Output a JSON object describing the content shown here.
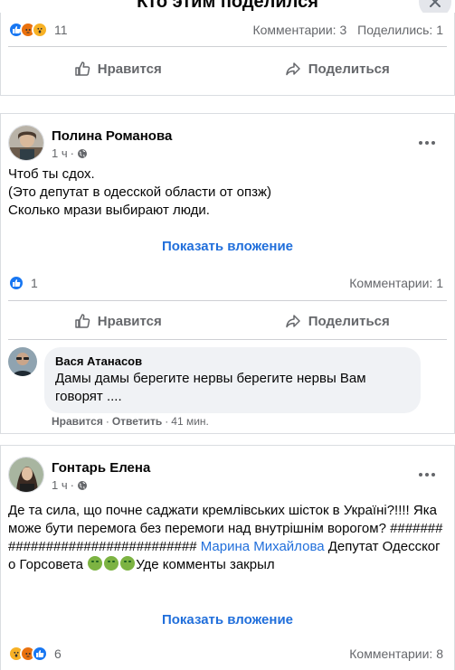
{
  "modal": {
    "title": "Кто этим поделился"
  },
  "top_post": {
    "reaction_count": "11",
    "comments": "Комментарии: 3",
    "shares": "Поделились: 1",
    "like_label": "Нравится",
    "share_label": "Поделиться"
  },
  "post1": {
    "author": "Полина Романова",
    "time": "1 ч",
    "dot": "·",
    "text": "Чтоб ты сдох.\n(Это депутат в одесской области от опзж)\nСколько мрази выбирают люди.",
    "show_attachment": "Показать вложение",
    "reaction_count": "1",
    "comments": "Комментарии: 1",
    "like_label": "Нравится",
    "share_label": "Поделиться",
    "comment": {
      "author": "Вася Атанасов",
      "text": "Дамы дамы берегите нервы берегите нервы Вам говорят ....",
      "like": "Нравится",
      "sep": "·",
      "reply": "Ответить",
      "time": "41 мин."
    }
  },
  "post2": {
    "author": "Гонтарь Елена",
    "time": "1 ч",
    "dot": "·",
    "text_main": "Де та сила, що почне саджати кремлівських шісток в Україні?!!!! Яка може бути перемога без перемоги над внутрішнім ворогом? ################################",
    "mention": "Марина Михайлова",
    "text_after": " Депутат Одесского Горсовета ",
    "text_end": "Уде комменты закрыл",
    "show_attachment": "Показать вложение",
    "reaction_count": "6",
    "comments": "Комментарии: 8"
  },
  "colors": {
    "accent": "#216fdb",
    "like": "#1877f2",
    "angry": "#e9710f",
    "wow": "#f7b125",
    "nauseated": "#7cb342"
  }
}
